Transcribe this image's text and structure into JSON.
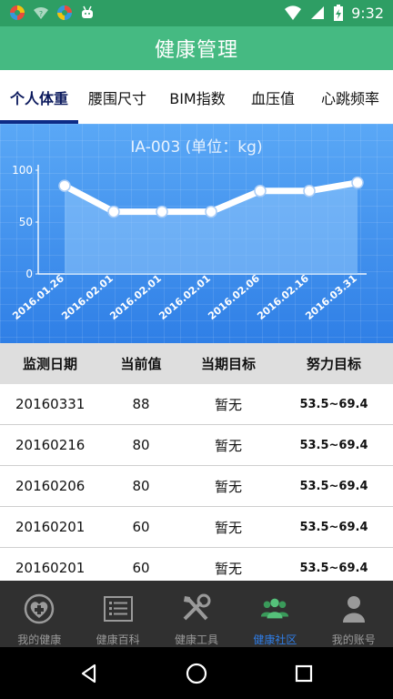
{
  "status_bar": {
    "time": "9:32",
    "icons": [
      "app-icon-1",
      "wifi-question-icon",
      "app-icon-2",
      "android-icon",
      "wifi-icon",
      "signal-icon",
      "battery-charging-icon"
    ]
  },
  "header": {
    "title": "健康管理"
  },
  "tabs": [
    {
      "label": "个人体重",
      "active": true
    },
    {
      "label": "腰围尺寸",
      "active": false
    },
    {
      "label": "BIM指数",
      "active": false
    },
    {
      "label": "血压值",
      "active": false
    },
    {
      "label": "心跳频率",
      "active": false
    }
  ],
  "chart_data": {
    "type": "line",
    "title": "IA-003 (单位：kg)",
    "categories": [
      "2016.01.26",
      "2016.02.01",
      "2016.02.01",
      "2016.02.01",
      "2016.02.06",
      "2016.02.16",
      "2016.03.31"
    ],
    "values": [
      85,
      60,
      60,
      60,
      80,
      80,
      88
    ],
    "y_ticks": [
      "0",
      "50",
      "100"
    ],
    "ylim": [
      0,
      100
    ],
    "colors": {
      "line": "#ffffff",
      "fill": "#8fc6fb"
    }
  },
  "table": {
    "headers": [
      "监测日期",
      "当前值",
      "当期目标",
      "努力目标"
    ],
    "rows": [
      {
        "date": "20160331",
        "value": "88",
        "target": "暂无",
        "goal": "53.5~69.4"
      },
      {
        "date": "20160216",
        "value": "80",
        "target": "暂无",
        "goal": "53.5~69.4"
      },
      {
        "date": "20160206",
        "value": "80",
        "target": "暂无",
        "goal": "53.5~69.4"
      },
      {
        "date": "20160201",
        "value": "60",
        "target": "暂无",
        "goal": "53.5~69.4"
      },
      {
        "date": "20160201",
        "value": "60",
        "target": "暂无",
        "goal": "53.5~69.4"
      }
    ]
  },
  "bottom_nav": [
    {
      "label": "我的健康",
      "icon": "heart-plus-icon",
      "active": false
    },
    {
      "label": "健康百科",
      "icon": "list-icon",
      "active": false
    },
    {
      "label": "健康工具",
      "icon": "tools-icon",
      "active": false
    },
    {
      "label": "健康社区",
      "icon": "community-icon",
      "active": true
    },
    {
      "label": "我的账号",
      "icon": "person-icon",
      "active": false
    }
  ],
  "system_nav": [
    "back-icon",
    "home-icon",
    "recents-icon"
  ],
  "colors": {
    "status": "#2e9e64",
    "header": "#45ba82",
    "accent": "#0d2b86",
    "active_nav": "#2f7de6"
  }
}
